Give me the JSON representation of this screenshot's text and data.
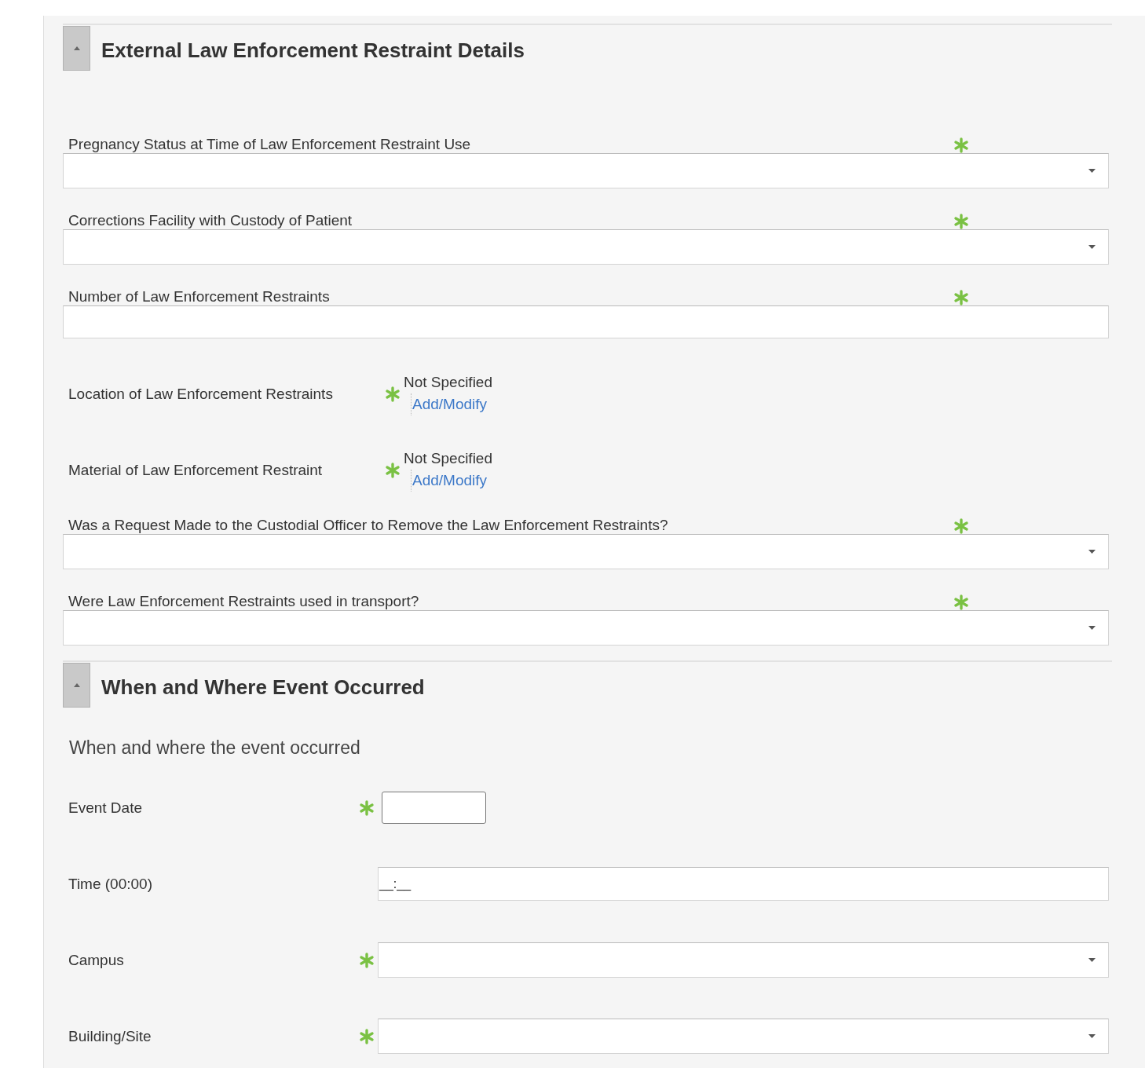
{
  "sections": [
    {
      "title": "External Law Enforcement Restraint Details",
      "expanded": true,
      "fields": [
        {
          "kind": "select",
          "label": "Pregnancy Status at Time of Law Enforcement Restraint Use",
          "required": true
        },
        {
          "kind": "select",
          "label": "Corrections Facility with Custody of Patient",
          "required": true
        },
        {
          "kind": "text",
          "label": "Number of Law Enforcement Restraints",
          "required": true
        },
        {
          "kind": "picker",
          "label": "Location of Law Enforcement Restraints",
          "required": true,
          "value": "Not Specified",
          "link": "Add/Modify"
        },
        {
          "kind": "picker",
          "label": "Material of Law Enforcement Restraint",
          "required": true,
          "value": "Not Specified",
          "link": "Add/Modify"
        },
        {
          "kind": "select",
          "label": "Was a Request Made to the Custodial Officer to Remove the Law Enforcement Restraints?",
          "required": true
        },
        {
          "kind": "select",
          "label": "Were Law Enforcement Restraints used in transport?",
          "required": true
        }
      ]
    },
    {
      "title": "When and Where Event Occurred",
      "expanded": true,
      "description": "When and where the event occurred",
      "fields": [
        {
          "kind": "date",
          "label": "Event Date",
          "required": true
        },
        {
          "kind": "time",
          "label": "Time (00:00)",
          "required": false,
          "value": "__:__"
        },
        {
          "kind": "inline-select",
          "label": "Campus",
          "required": true
        },
        {
          "kind": "inline-select",
          "label": "Building/Site",
          "required": true
        }
      ]
    }
  ]
}
